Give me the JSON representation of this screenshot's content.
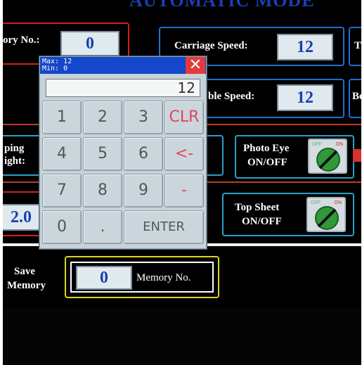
{
  "screen": {
    "title": "AUTOMATIC MODE",
    "memory_no_label": "ory No.:",
    "memory_no_value": "0",
    "carriage_speed_label": "Carriage Speed:",
    "carriage_speed_value": "12",
    "cut1": "T",
    "table_speed_label": "ble Speed:",
    "table_speed_value": "12",
    "cut2": "Be",
    "stopping_label_1": "ping",
    "stopping_label_2": "ight:",
    "stopping_value": "2.0",
    "photo_eye_label_1": "Photo Eye",
    "photo_eye_label_2": "ON/OFF",
    "top_sheet_label_1": "Top Sheet",
    "top_sheet_label_2": "ON/OFF",
    "toggle_off": "OFF",
    "toggle_on": "ON",
    "save_memory_label_1": "Save",
    "save_memory_label_2": "Memory",
    "save_memory_value": "0",
    "save_memory_suffix": "Memory No."
  },
  "keypad": {
    "max": "Max: 12",
    "min": "Min: 0",
    "close": "✕",
    "display": "12",
    "keys": [
      "1",
      "2",
      "3",
      "CLR",
      "4",
      "5",
      "6",
      "<-",
      "7",
      "8",
      "9",
      "-",
      "0",
      ".",
      "ENTER"
    ]
  },
  "colors": {
    "accent_blue": "#1447c9",
    "close_red": "#e23b3b",
    "panel_cyan": "#2aa0c8",
    "panel_yellow": "#e0d41a"
  }
}
